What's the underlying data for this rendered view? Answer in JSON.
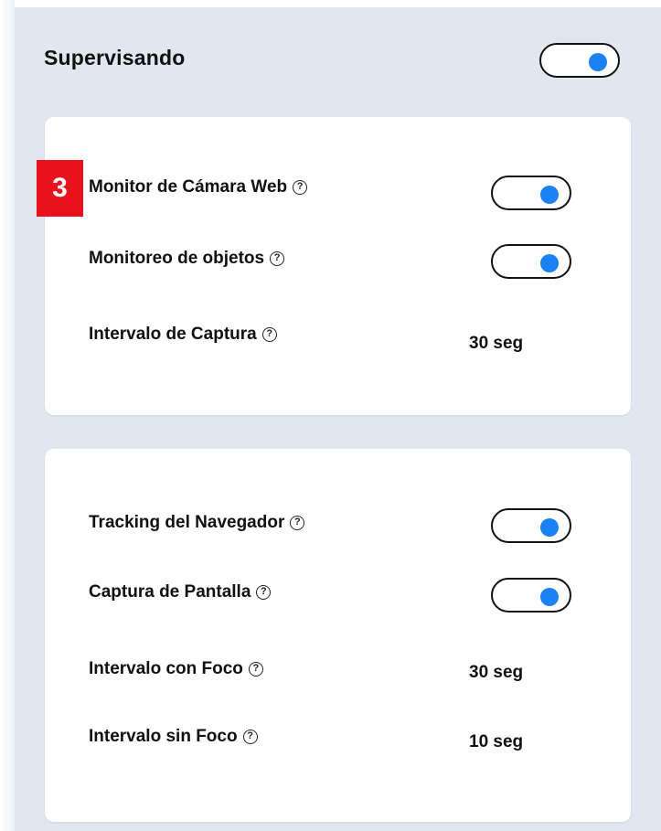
{
  "header": {
    "title": "Supervisando",
    "toggle_on": true
  },
  "step_badge": "3",
  "card1": {
    "webcam": {
      "label": "Monitor de Cámara Web",
      "toggle_on": true
    },
    "objects": {
      "label": "Monitoreo de objetos",
      "toggle_on": true
    },
    "capture_interval": {
      "label": "Intervalo de Captura",
      "value": "30 seg"
    }
  },
  "card2": {
    "browser_tracking": {
      "label": "Tracking del Navegador",
      "toggle_on": true
    },
    "screen_capture": {
      "label": "Captura de Pantalla",
      "toggle_on": true
    },
    "focus_interval": {
      "label": "Intervalo con Foco",
      "value": "30 seg"
    },
    "nofocus_interval": {
      "label": "Intervalo sin Foco",
      "value": "10 seg"
    }
  },
  "icons": {
    "help": "help-circle-icon"
  },
  "colors": {
    "accent": "#1a82f4",
    "badge": "#e8121a",
    "panel": "#e1e7f0"
  }
}
